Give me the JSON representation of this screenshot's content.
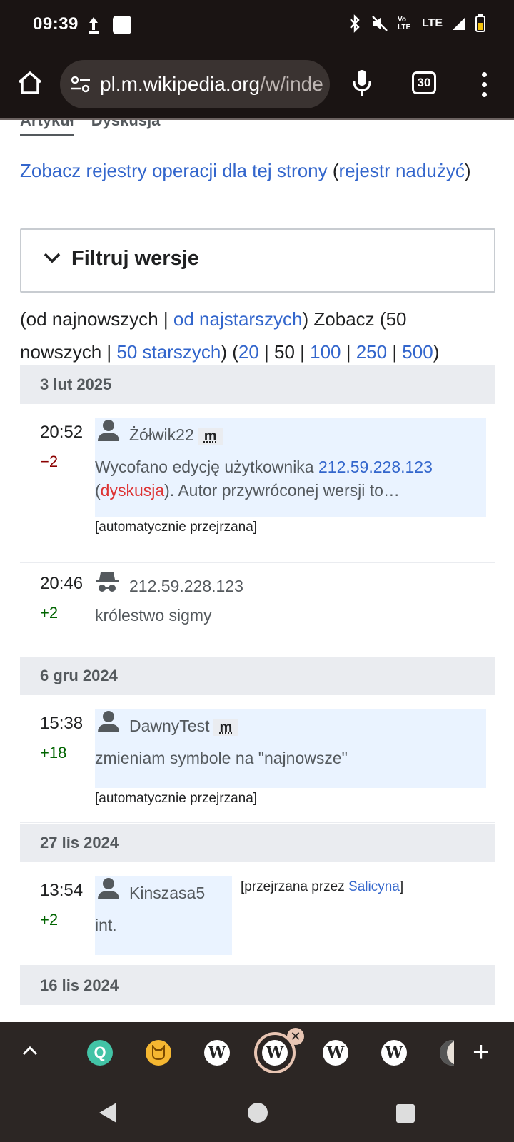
{
  "status_bar": {
    "time": "09:39",
    "network": "LTE",
    "volte": "Vo LTE"
  },
  "browser": {
    "url_host": "pl.m.wikipedia.org",
    "url_path": "/w/inde",
    "tab_count": "30"
  },
  "page": {
    "tabs": [
      "Artykuł",
      "Dyskusja"
    ],
    "logs_link": "Zobacz rejestry operacji dla tej strony",
    "abuse_link": "rejestr nadużyć",
    "filter_label": "Filtruj wersje",
    "nav": {
      "newest": "od najnowszych",
      "oldest_link": "od najstarszych",
      "see": "Zobacz (50",
      "newer": "nowszych",
      "older_link": "50 starszych",
      "limits": [
        "20",
        "50",
        "100",
        "250",
        "500"
      ]
    }
  },
  "history": [
    {
      "date": "3 lut 2025",
      "entries": [
        {
          "time": "20:52",
          "diff": "−2",
          "user": "Żółwik22",
          "minor": "m",
          "summary_a": "Wycofano edycję użytkownika ",
          "summary_ip": "212.59.228.123",
          "summary_talk": "dyskusja",
          "summary_b": "). Autor przywróconej wersji to…",
          "tag": "[automatycznie przejrzana]"
        },
        {
          "time": "20:46",
          "diff": "+2",
          "user": "212.59.228.123",
          "summary": "królestwo sigmy"
        }
      ]
    },
    {
      "date": "6 gru 2024",
      "entries": [
        {
          "time": "15:38",
          "diff": "+18",
          "user": "DawnyTest",
          "minor": "m",
          "summary": "zmieniam symbole na \"najnowsze\"",
          "tag": "[automatycznie przejrzana]"
        }
      ]
    },
    {
      "date": "27 lis 2024",
      "entries": [
        {
          "time": "13:54",
          "diff": "+2",
          "user": "Kinszasa5",
          "summary": "int.",
          "review_prefix": "[przejrzana przez ",
          "reviewer": "Salicyna",
          "review_suffix": "]"
        }
      ]
    },
    {
      "date": "16 lis 2024"
    }
  ],
  "colors": {
    "link": "#3366cc",
    "red_link": "#d33",
    "negative": "#8b0000",
    "positive": "#006400"
  },
  "tab_strip": [
    "quillbot-icon",
    "cat-icon",
    "wikipedia-icon",
    "wikipedia-icon",
    "wikipedia-icon",
    "wikipedia-icon",
    "moon-icon"
  ]
}
